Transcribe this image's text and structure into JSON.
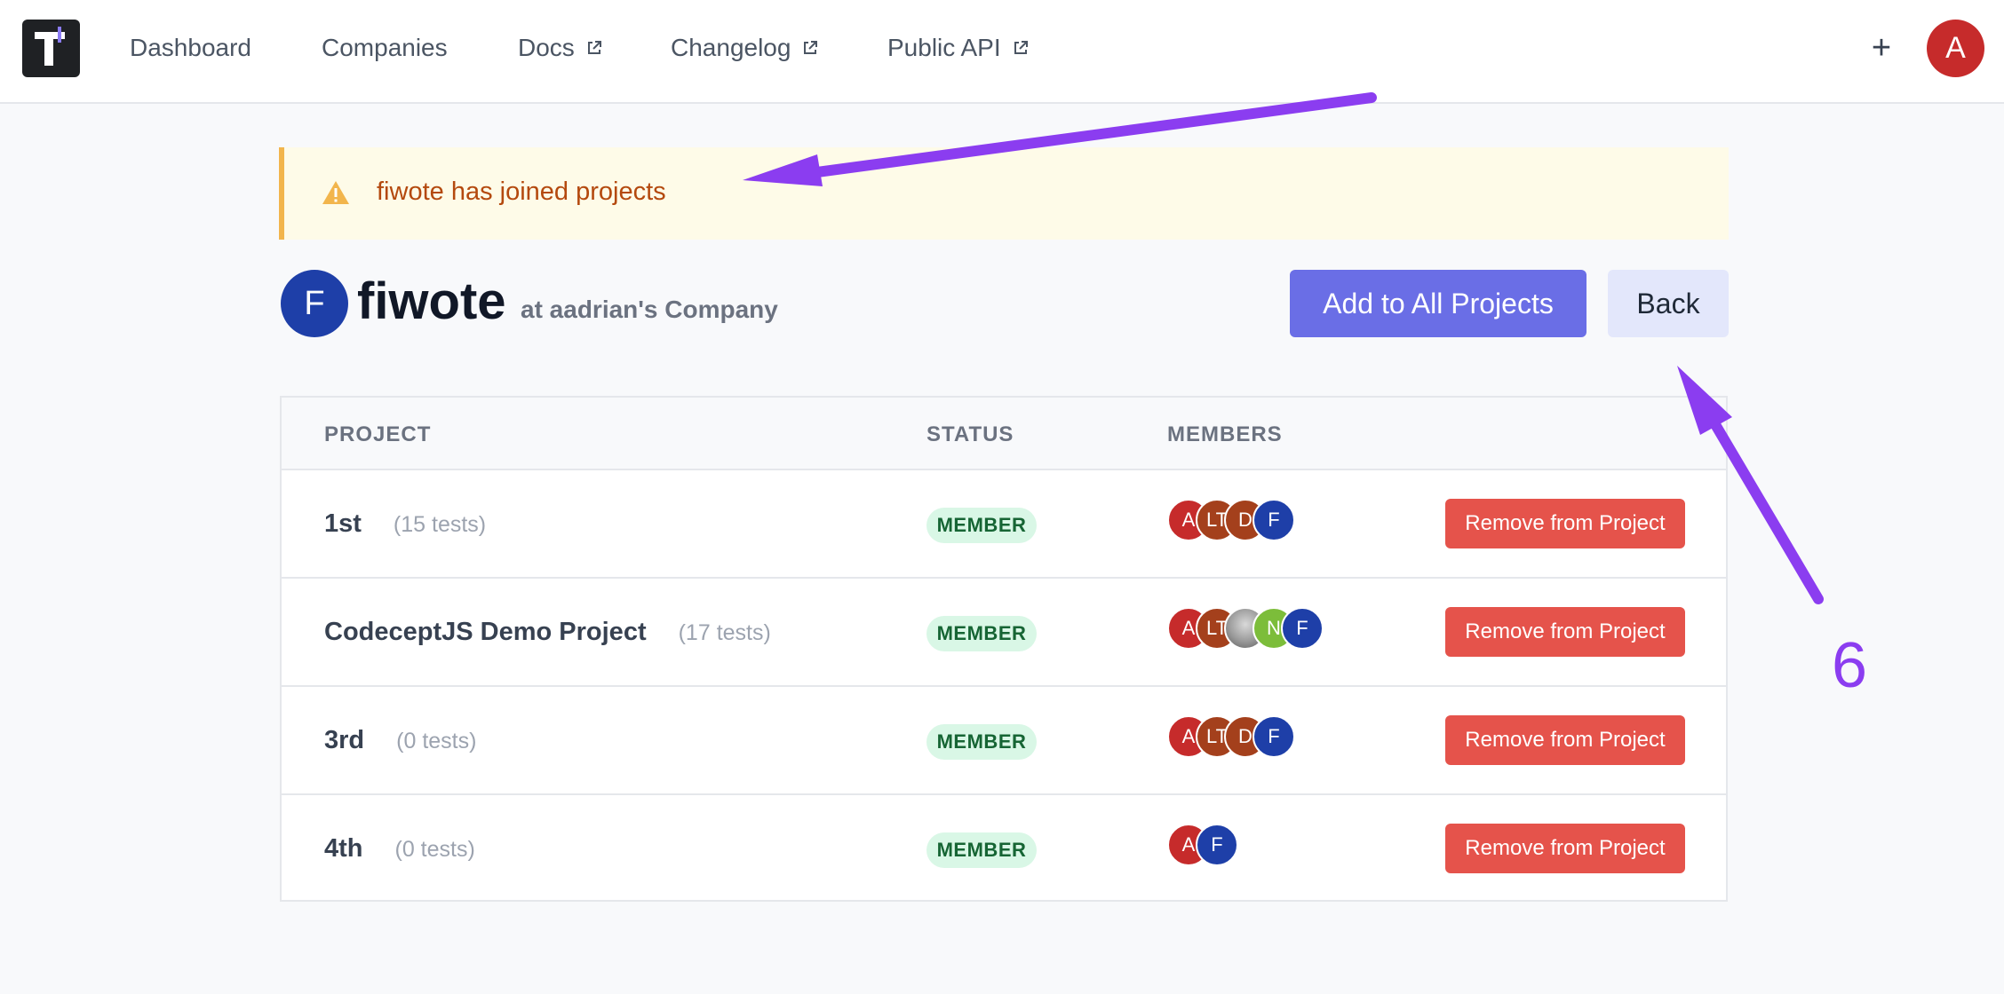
{
  "nav": {
    "items": [
      {
        "label": "Dashboard",
        "external": false
      },
      {
        "label": "Companies",
        "external": false
      },
      {
        "label": "Docs",
        "external": true
      },
      {
        "label": "Changelog",
        "external": true
      },
      {
        "label": "Public API",
        "external": true
      }
    ],
    "plus_label": "+",
    "user_initial": "A"
  },
  "flash": {
    "message": "fiwote has joined projects",
    "icon": "warning-icon"
  },
  "user": {
    "initial": "F",
    "name": "fiwote",
    "company": "at aadrian's Company"
  },
  "actions": {
    "add_all_label": "Add to All Projects",
    "back_label": "Back"
  },
  "table": {
    "headers": {
      "project": "PROJECT",
      "status": "STATUS",
      "members": "MEMBERS"
    },
    "rows": [
      {
        "name": "1st",
        "tests": "(15 tests)",
        "status": "MEMBER",
        "members": [
          {
            "initial": "A",
            "color": "#c62b2b"
          },
          {
            "initial": "LT",
            "color": "#a4401c"
          },
          {
            "initial": "D",
            "color": "#a4401c"
          },
          {
            "initial": "F",
            "color": "#1e3fa8"
          }
        ],
        "action": "Remove from Project"
      },
      {
        "name": "CodeceptJS Demo Project",
        "tests": "(17 tests)",
        "status": "MEMBER",
        "members": [
          {
            "initial": "A",
            "color": "#c62b2b"
          },
          {
            "initial": "LT",
            "color": "#a4401c"
          },
          {
            "initial": "",
            "color": "#8d8d8d"
          },
          {
            "initial": "N",
            "color": "#7cbd3a"
          },
          {
            "initial": "F",
            "color": "#1e3fa8"
          }
        ],
        "action": "Remove from Project"
      },
      {
        "name": "3rd",
        "tests": "(0 tests)",
        "status": "MEMBER",
        "members": [
          {
            "initial": "A",
            "color": "#c62b2b"
          },
          {
            "initial": "LT",
            "color": "#a4401c"
          },
          {
            "initial": "D",
            "color": "#a4401c"
          },
          {
            "initial": "F",
            "color": "#1e3fa8"
          }
        ],
        "action": "Remove from Project"
      },
      {
        "name": "4th",
        "tests": "(0 tests)",
        "status": "MEMBER",
        "members": [
          {
            "initial": "A",
            "color": "#c62b2b"
          },
          {
            "initial": "F",
            "color": "#1e3fa8"
          }
        ],
        "action": "Remove from Project"
      }
    ]
  },
  "annotation": {
    "step_number": "6",
    "color": "#8b3df0"
  }
}
